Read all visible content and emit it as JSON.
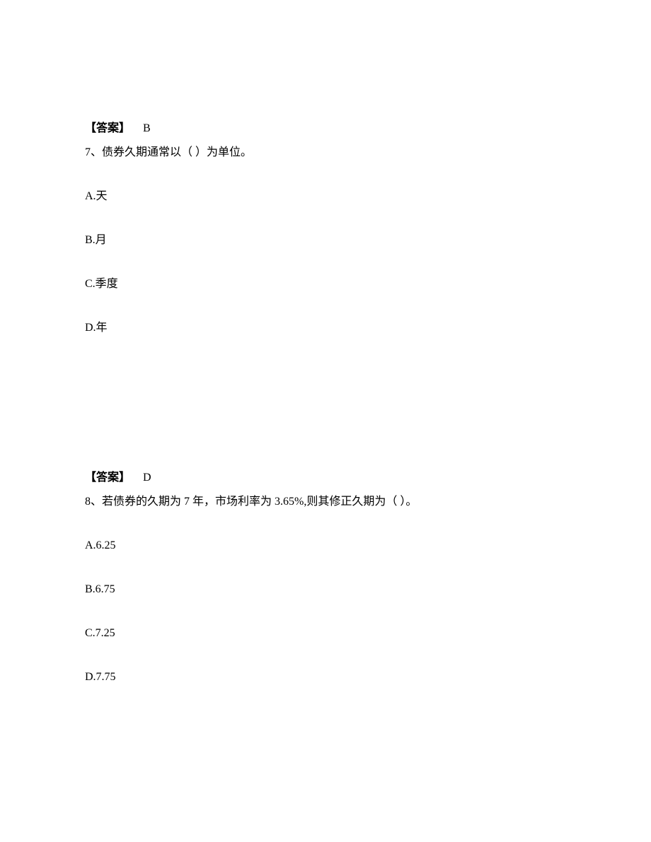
{
  "block1": {
    "answer_label": "【答案】",
    "answer_value": "B",
    "question_number": "7、",
    "question_text": "债券久期通常以（ ）为单位。",
    "options": {
      "a": "A.天",
      "b": "B.月",
      "c": "C.季度",
      "d": "D.年"
    }
  },
  "block2": {
    "answer_label": "【答案】",
    "answer_value": "D",
    "question_number": "8、",
    "question_text": "若债券的久期为 7 年，市场利率为 3.65%,则其修正久期为（ ）。",
    "options": {
      "a": "A.6.25",
      "b": "B.6.75",
      "c": "C.7.25",
      "d": "D.7.75"
    }
  }
}
